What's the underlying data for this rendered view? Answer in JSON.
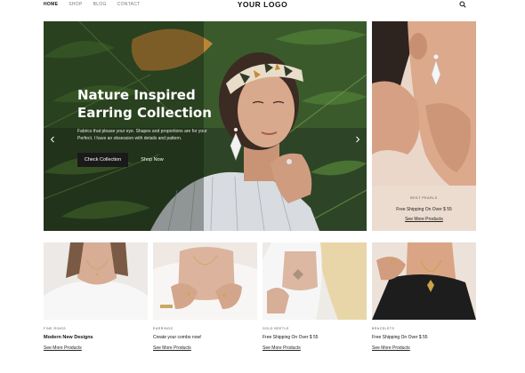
{
  "nav": {
    "links": [
      "HOME",
      "SHOP",
      "BLOG",
      "CONTACT"
    ],
    "active": "HOME",
    "logo": "YOUR LOGO",
    "search_icon": "search-icon"
  },
  "hero": {
    "title": "Nature Inspired Earring Collection",
    "description": "Fabrics that please your eye. Shapes and proportions are for your Perfect. I have an obsession with details and pattern.",
    "primary_button": "Check Collection",
    "secondary_button": "Shop Now",
    "prev_icon": "chevron-left-icon",
    "next_icon": "chevron-right-icon"
  },
  "side_card": {
    "category": "Best Pearls",
    "title": "Free Shipping On Over $ 55",
    "link": "See More Products"
  },
  "products": [
    {
      "category": "Fine Rings",
      "title": "Modern New Designs",
      "link": "See More Products"
    },
    {
      "category": "Earrings",
      "title": "Create your combo now!",
      "link": "See More Products"
    },
    {
      "category": "Gold Beetle",
      "title": "Free Shipping On Over $ 55",
      "link": "See More Products"
    },
    {
      "category": "Bracelets",
      "title": "Free Shipping On Over $ 55",
      "link": "See More Products"
    }
  ],
  "colors": {
    "button_dark": "#1a1a1a",
    "foliage": "#2f4a22",
    "skin": "#d9a98d"
  }
}
